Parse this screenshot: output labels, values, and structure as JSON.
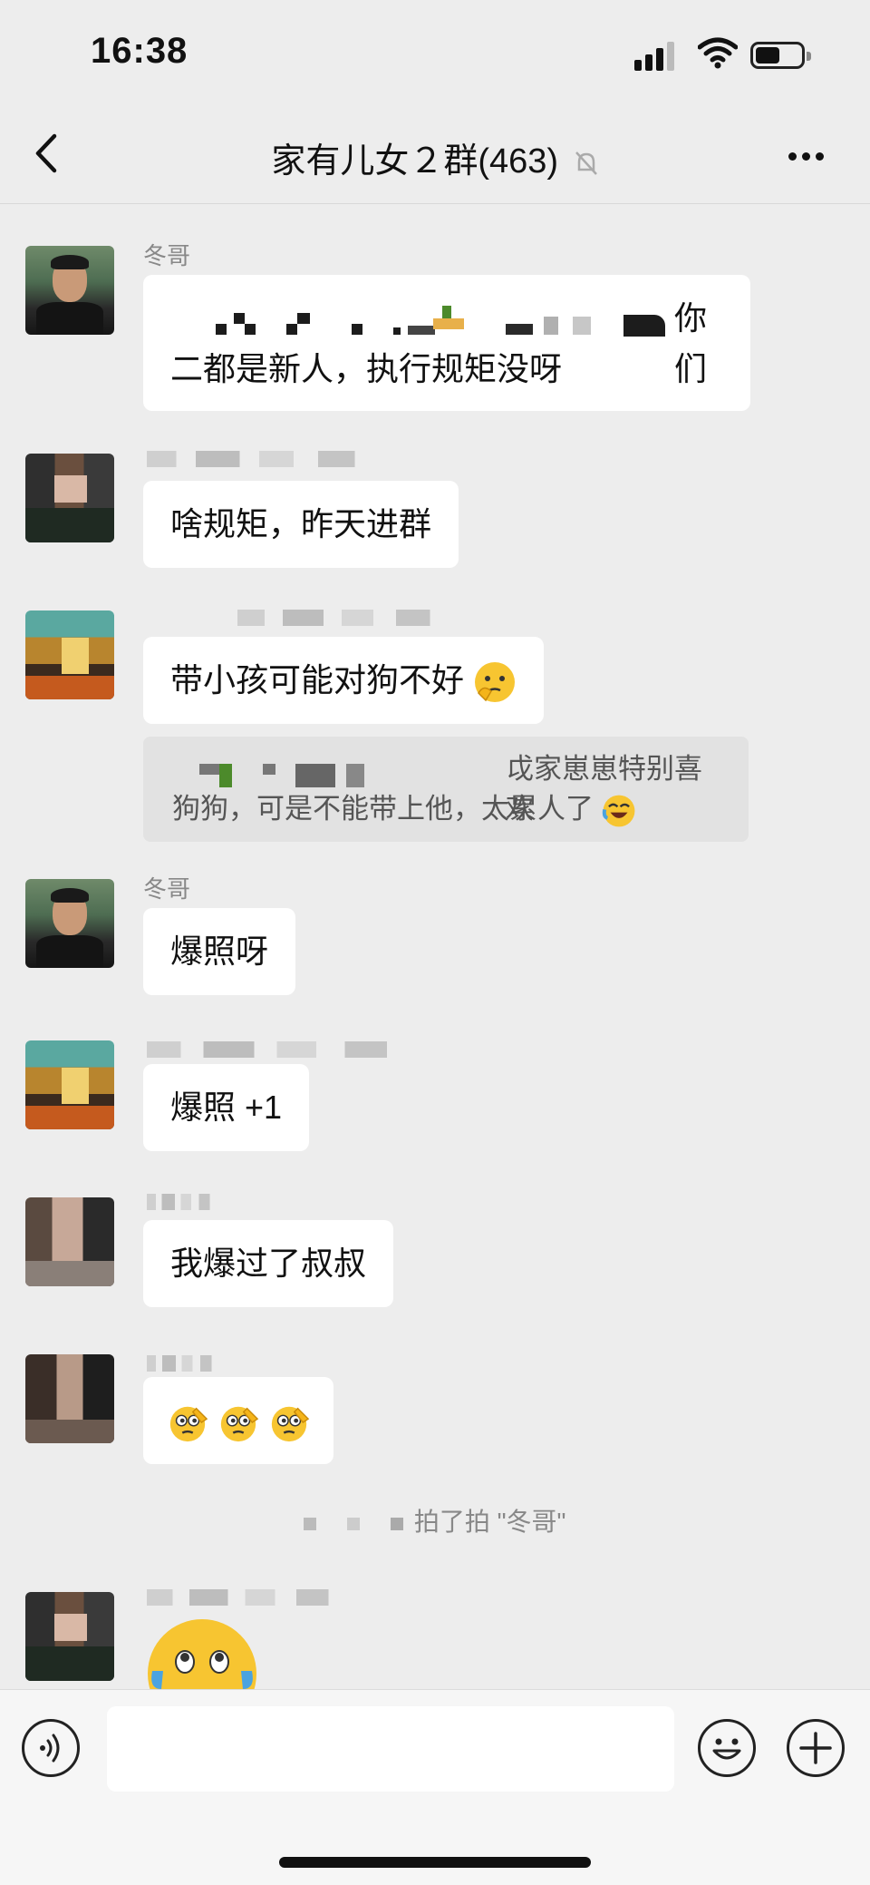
{
  "status": {
    "time": "16:38"
  },
  "nav": {
    "title": "家有儿女２群(463)"
  },
  "messages": {
    "m1": {
      "sender": "冬哥",
      "line1": "你们",
      "line2": "二都是新人，执行规矩没呀"
    },
    "m2": {
      "text": "啥规矩，昨天进群"
    },
    "m3": {
      "text": "带小孩可能对狗不好",
      "quote_line1": "戉家崽崽特别喜欢",
      "quote_line2": "狗狗，可是不能带上他，太累人了"
    },
    "m4": {
      "sender": "冬哥",
      "text": "爆照呀"
    },
    "m5": {
      "text": "爆照 +1"
    },
    "m6": {
      "text": "我爆过了叔叔"
    },
    "system": "拍了拍 \"冬哥\""
  },
  "icons": {
    "back": "chevron-left-icon",
    "mute": "bell-slash-icon",
    "more": "more-dots-icon",
    "voice": "voice-icon",
    "emoji": "smiley-icon",
    "plus": "plus-icon"
  }
}
